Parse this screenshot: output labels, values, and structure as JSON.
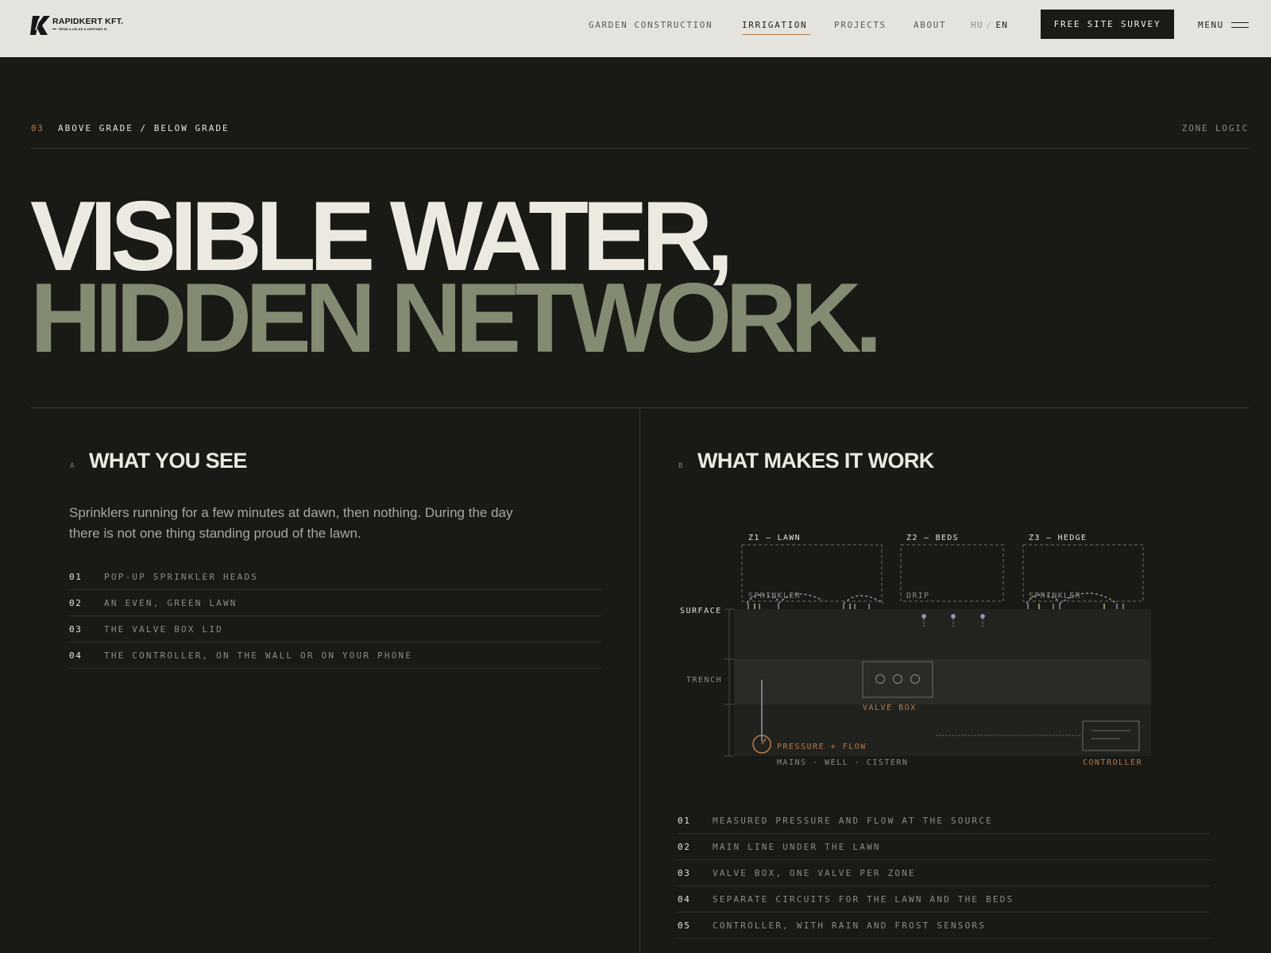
{
  "header": {
    "logo": {
      "name": "RAPIDKERT KFT.",
      "tagline": "REND A LELKE A KERTNEK IS"
    },
    "nav": [
      {
        "label": "GARDEN CONSTRUCTION",
        "active": false
      },
      {
        "label": "IRRIGATION",
        "active": true
      },
      {
        "label": "PROJECTS",
        "active": false
      },
      {
        "label": "ABOUT",
        "active": false
      }
    ],
    "lang": {
      "other": "HU",
      "separator": "/",
      "current": "EN"
    },
    "cta": "FREE SITE SURVEY",
    "menu": "MENU"
  },
  "section": {
    "number": "03",
    "title": "ABOVE GRADE / BELOW GRADE",
    "right_label": "ZONE LOGIC"
  },
  "hero": {
    "line1": "VISIBLE WATER,",
    "line2": "HIDDEN NETWORK."
  },
  "left": {
    "letter": "A",
    "title": "WHAT YOU SEE",
    "intro": "Sprinklers running for a few minutes at dawn, then nothing. During the day there is not one thing standing proud of the lawn.",
    "items": [
      {
        "num": "01",
        "text": "POP-UP SPRINKLER HEADS"
      },
      {
        "num": "02",
        "text": "AN EVEN, GREEN LAWN"
      },
      {
        "num": "03",
        "text": "THE VALVE BOX LID"
      },
      {
        "num": "04",
        "text": "THE CONTROLLER, ON THE WALL OR ON YOUR PHONE"
      }
    ]
  },
  "right": {
    "letter": "B",
    "title": "WHAT MAKES IT WORK",
    "diagram": {
      "zones": [
        {
          "label": "Z1 — LAWN",
          "type": "SPRINKLER"
        },
        {
          "label": "Z2 — BEDS",
          "type": "DRIP"
        },
        {
          "label": "Z3 — HEDGE",
          "type": "SPRINKLER"
        }
      ],
      "layers": {
        "surface": "SURFACE",
        "trench": "TRENCH"
      },
      "valve_box": "VALVE BOX",
      "source": {
        "label": "PRESSURE + FLOW",
        "sub": "MAINS · WELL · CISTERN"
      },
      "controller": "CONTROLLER",
      "colors": {
        "accent": "#b47a4d",
        "blue": "#8f9aab",
        "grey": "#6d6c66"
      }
    },
    "items": [
      {
        "num": "01",
        "text": "MEASURED PRESSURE AND FLOW AT THE SOURCE"
      },
      {
        "num": "02",
        "text": "MAIN LINE UNDER THE LAWN"
      },
      {
        "num": "03",
        "text": "VALVE BOX, ONE VALVE PER ZONE"
      },
      {
        "num": "04",
        "text": "SEPARATE CIRCUITS FOR THE LAWN AND THE BEDS"
      },
      {
        "num": "05",
        "text": "CONTROLLER, WITH RAIN AND FROST SENSORS"
      }
    ]
  }
}
